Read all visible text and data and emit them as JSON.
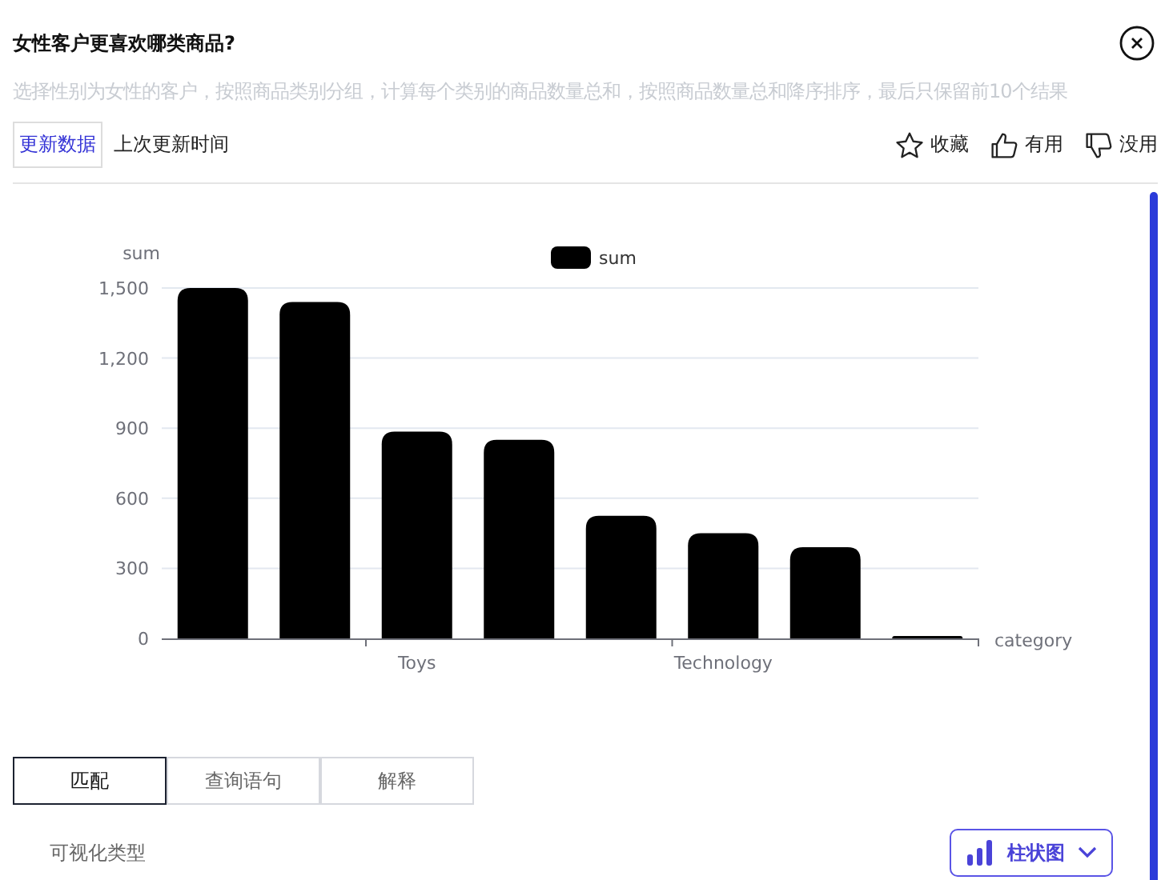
{
  "title": "女性客户更喜欢哪类商品?",
  "description": "选择性别为女性的客户，按照商品类别分组，计算每个类别的商品数量总和，按照商品数量总和降序排序，最后只保留前10个结果",
  "toolbar": {
    "update_button": "更新数据",
    "last_update_label": "上次更新时间",
    "actions": [
      {
        "kind": "star",
        "label": "收藏"
      },
      {
        "kind": "like",
        "label": "有用"
      },
      {
        "kind": "dislike",
        "label": "没用"
      }
    ]
  },
  "chart": {
    "chart_data": {
      "type": "bar",
      "xlabel": "category",
      "ylabel": "sum",
      "series": [
        {
          "name": "sum",
          "color": "#000000",
          "values": [
            1500,
            1440,
            885,
            850,
            525,
            450,
            390,
            10
          ]
        }
      ],
      "categories": [
        null,
        null,
        "Toys",
        null,
        null,
        "Technology",
        null,
        null
      ],
      "grid": true,
      "ylim": [
        0,
        1500
      ],
      "yticks": [
        {
          "value": 0,
          "label": "0"
        },
        {
          "value": 300,
          "label": "300"
        },
        {
          "value": 600,
          "label": "600"
        },
        {
          "value": 900,
          "label": "900"
        },
        {
          "value": 1200,
          "label": "1,200"
        },
        {
          "value": 1500,
          "label": "1,500"
        }
      ]
    }
  },
  "tabs": [
    {
      "label": "匹配",
      "selected": true
    },
    {
      "label": "查询语句",
      "selected": false
    },
    {
      "label": "解释",
      "selected": false
    }
  ],
  "visualization": {
    "label": "可视化类型",
    "dropdown": "柱状图"
  }
}
